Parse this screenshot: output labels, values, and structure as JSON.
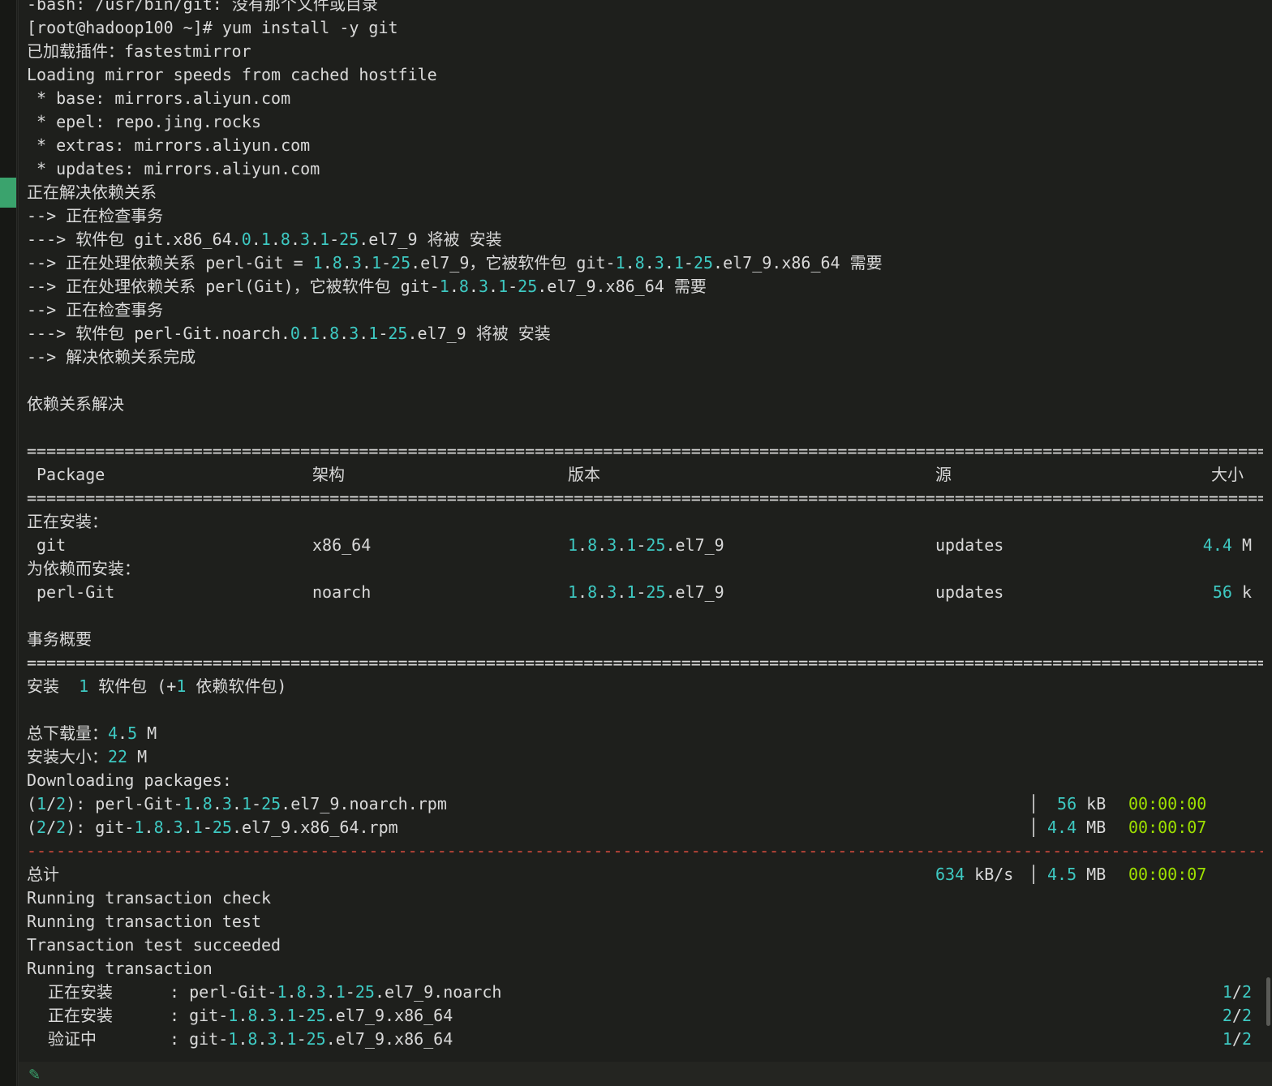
{
  "terminal": {
    "lines": [
      "-bash: /usr/bin/git: 没有那个文件或目录",
      "[root@hadoop100 ~]# yum install -y git",
      "已加载插件：fastestmirror",
      "Loading mirror speeds from cached hostfile",
      " * base: mirrors.aliyun.com",
      " * epel: repo.jing.rocks",
      " * extras: mirrors.aliyun.com",
      " * updates: mirrors.aliyun.com",
      "正在解决依赖关系",
      "--> 正在检查事务",
      "---> 软件包 git.x86_64.0.1.8.3.1-25.el7_9 将被 安装",
      "--> 正在处理依赖关系 perl-Git = 1.8.3.1-25.el7_9，它被软件包 git-1.8.3.1-25.el7_9.x86_64 需要",
      "--> 正在处理依赖关系 perl(Git)，它被软件包 git-1.8.3.1-25.el7_9.x86_64 需要",
      "--> 正在检查事务",
      "---> 软件包 perl-Git.noarch.0.1.8.3.1-25.el7_9 将被 安装",
      "--> 解决依赖关系完成",
      "",
      "依赖关系解决",
      ""
    ],
    "rule_eq": "================================================================================================================================",
    "rule_dash": "--------------------------------------------------------------------------------------------------------------------------------",
    "table_header": {
      "package": "Package",
      "arch": "架构",
      "version": "版本",
      "repo": "源",
      "size": "大小"
    },
    "installing_label": "正在安装：",
    "dep_label": "为依赖而安装：",
    "packages": [
      {
        "name": "git",
        "arch": "x86_64",
        "version": "1.8.3.1-25.el7_9",
        "repo": "updates",
        "size": "4.4 M"
      },
      {
        "name": "perl-Git",
        "arch": "noarch",
        "version": "1.8.3.1-25.el7_9",
        "repo": "updates",
        "size": "56 k"
      }
    ],
    "summary_title": "事务概要",
    "summary_line": "安装  1 软件包 (+1 依赖软件包)",
    "total_download": "总下载量：4.5 M",
    "install_size": "安装大小：22 M",
    "downloading": "Downloading packages:",
    "downloads": [
      {
        "name": "(1/2): perl-Git-1.8.3.1-25.el7_9.noarch.rpm",
        "size": " 56 kB",
        "time": "00:00:00"
      },
      {
        "name": "(2/2): git-1.8.3.1-25.el7_9.x86_64.rpm",
        "size": "4.4 MB",
        "time": "00:00:07"
      }
    ],
    "total": {
      "label": "总计",
      "speed": "634 kB/s",
      "size": "4.5 MB",
      "time": "00:00:07"
    },
    "post_lines": [
      "Running transaction check",
      "Running transaction test",
      "Transaction test succeeded",
      "Running transaction"
    ],
    "steps": [
      {
        "action": "正在安装",
        "pkg": "perl-Git-1.8.3.1-25.el7_9.noarch",
        "progress": "1/2"
      },
      {
        "action": "正在安装",
        "pkg": "git-1.8.3.1-25.el7_9.x86_64",
        "progress": "2/2"
      },
      {
        "action": "验证中",
        "pkg": "git-1.8.3.1-25.el7_9.x86_64",
        "progress": "1/2"
      }
    ]
  },
  "icons": {
    "bottom": "pen-icon"
  },
  "colors": {
    "number": "#3ec9c2",
    "time": "#9ee000",
    "rule_red": "#d0493b",
    "text": "#d9d9d9"
  }
}
